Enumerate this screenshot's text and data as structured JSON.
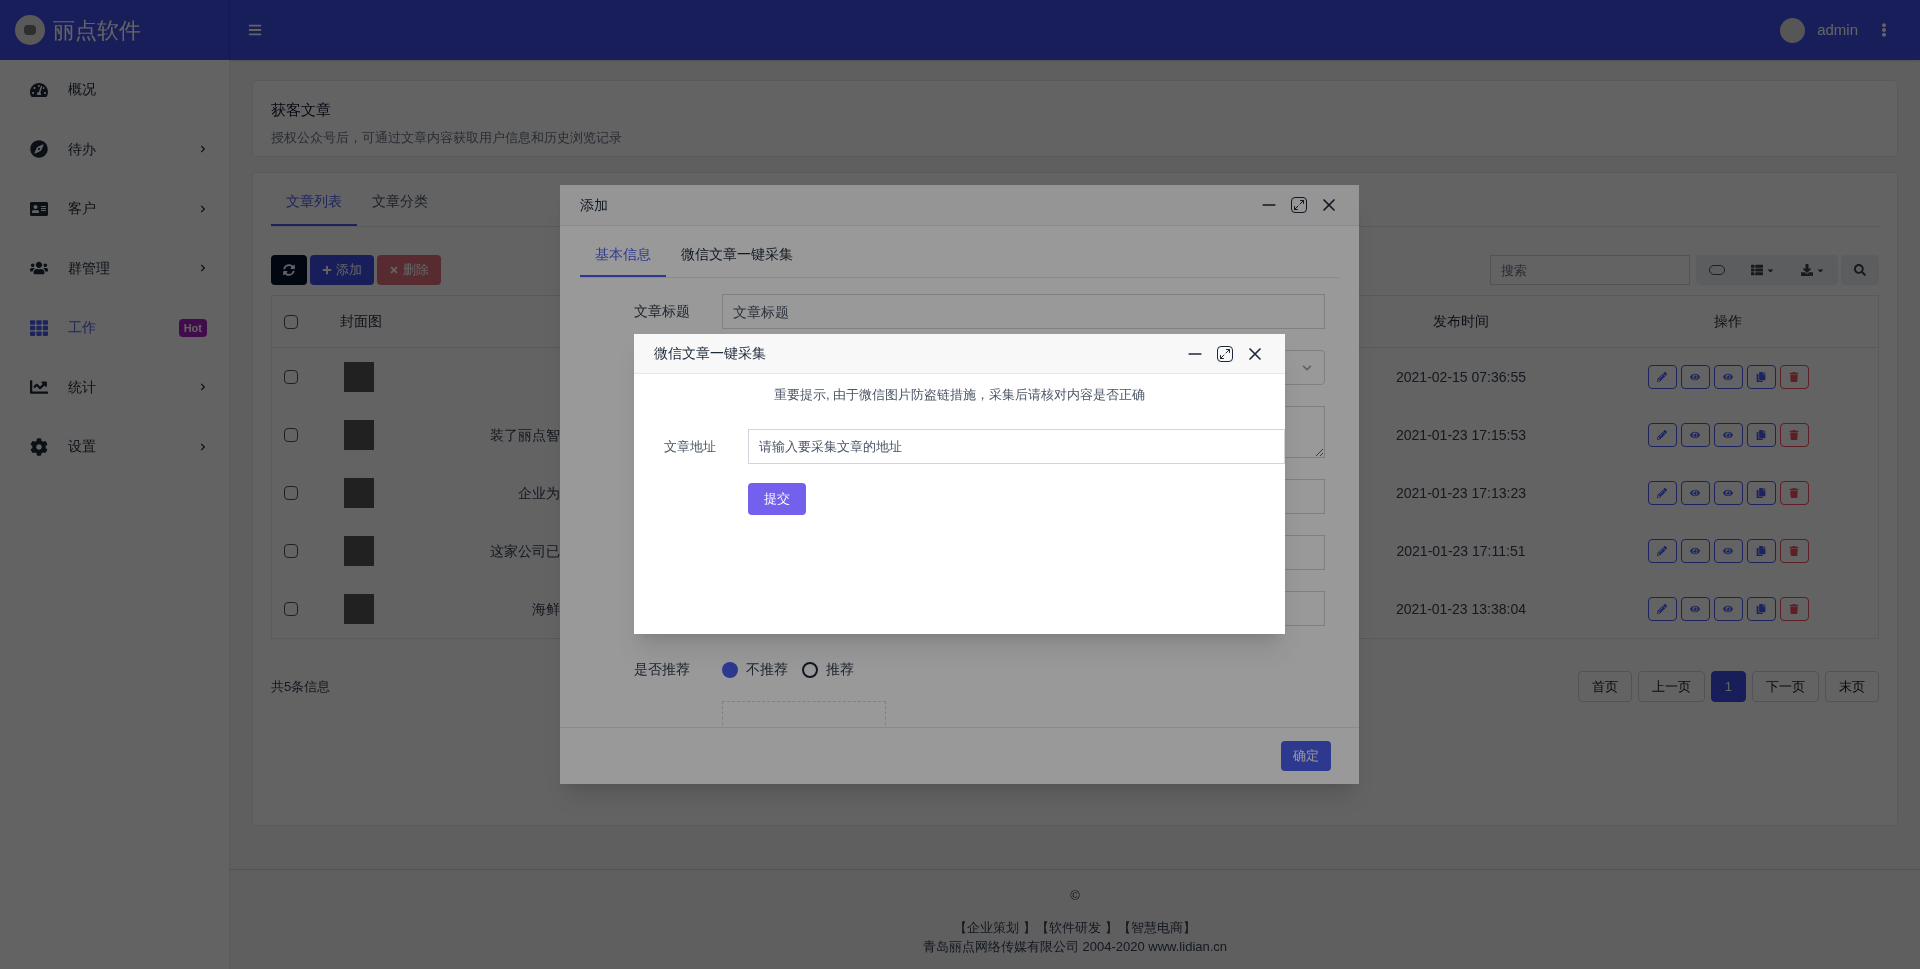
{
  "header": {
    "brand": "丽点软件",
    "user": "admin"
  },
  "sidebar": {
    "items": [
      {
        "label": "概况",
        "selected": false,
        "expandable": false
      },
      {
        "label": "待办",
        "selected": false,
        "expandable": true
      },
      {
        "label": "客户",
        "selected": false,
        "expandable": true
      },
      {
        "label": "群管理",
        "selected": false,
        "expandable": true
      },
      {
        "label": "工作",
        "selected": true,
        "expandable": false,
        "badge": "Hot"
      },
      {
        "label": "统计",
        "selected": false,
        "expandable": true
      },
      {
        "label": "设置",
        "selected": false,
        "expandable": true
      }
    ]
  },
  "page_header": {
    "title": "获客文章",
    "subtitle": "授权公众号后，可通过文章内容获取用户信息和历史浏览记录"
  },
  "tabs": [
    {
      "label": "文章列表",
      "selected": true
    },
    {
      "label": "文章分类",
      "selected": false
    }
  ],
  "toolbar": {
    "add": "添加",
    "delete": {
      "label": "删除",
      "disabled": true
    },
    "search_placeholder": "搜索"
  },
  "table": {
    "columns": [
      "封面图",
      "发布时间",
      "操作"
    ],
    "header_checked": false,
    "rows": [
      {
        "checked": false,
        "published": "2021-02-15 07:36:55"
      },
      {
        "checked": false,
        "title": "装了丽点智",
        "published": "2021-01-23 17:15:53"
      },
      {
        "checked": false,
        "title": "企业为",
        "published": "2021-01-23 17:13:23"
      },
      {
        "checked": false,
        "title": "这家公司已",
        "published": "2021-01-23 17:11:51"
      },
      {
        "checked": false,
        "title": "海鲜",
        "published": "2021-01-23 13:38:04"
      }
    ]
  },
  "summary": "共5条信息",
  "pagination": [
    {
      "label": "首页",
      "selected": false
    },
    {
      "label": "上一页",
      "selected": false
    },
    {
      "label": "1",
      "selected": true
    },
    {
      "label": "下一页",
      "selected": false
    },
    {
      "label": "末页",
      "selected": false
    }
  ],
  "footer": {
    "symbol": "©",
    "links": [
      "【企业策划 】",
      "【软件研发 】",
      "【智慧电商】"
    ],
    "copyright": "青岛丽点网络传媒有限公司 2004-2020 www.lidian.cn"
  },
  "add_dialog": {
    "title": "添加",
    "tabs": [
      {
        "label": "基本信息",
        "selected": true
      },
      {
        "label": "微信文章一键采集",
        "selected": false
      }
    ],
    "fields": [
      {
        "kind": "text",
        "label": "文章标题",
        "placeholder": "文章标题"
      },
      {
        "kind": "select"
      },
      {
        "kind": "textarea"
      },
      {
        "kind": "text"
      },
      {
        "kind": "text"
      },
      {
        "kind": "text"
      }
    ],
    "recommend": {
      "label": "是否推荐",
      "options": [
        {
          "label": "不推荐",
          "selected": true
        },
        {
          "label": "推荐",
          "selected": false
        }
      ]
    },
    "confirm": "确定"
  },
  "collect_dialog": {
    "title": "微信文章一键采集",
    "notice": "重要提示, 由于微信图片防盗链措施，采集后请核对内容是否正确",
    "field": {
      "label": "文章地址",
      "placeholder": "请输入要采集文章的地址"
    },
    "submit": "提交"
  }
}
